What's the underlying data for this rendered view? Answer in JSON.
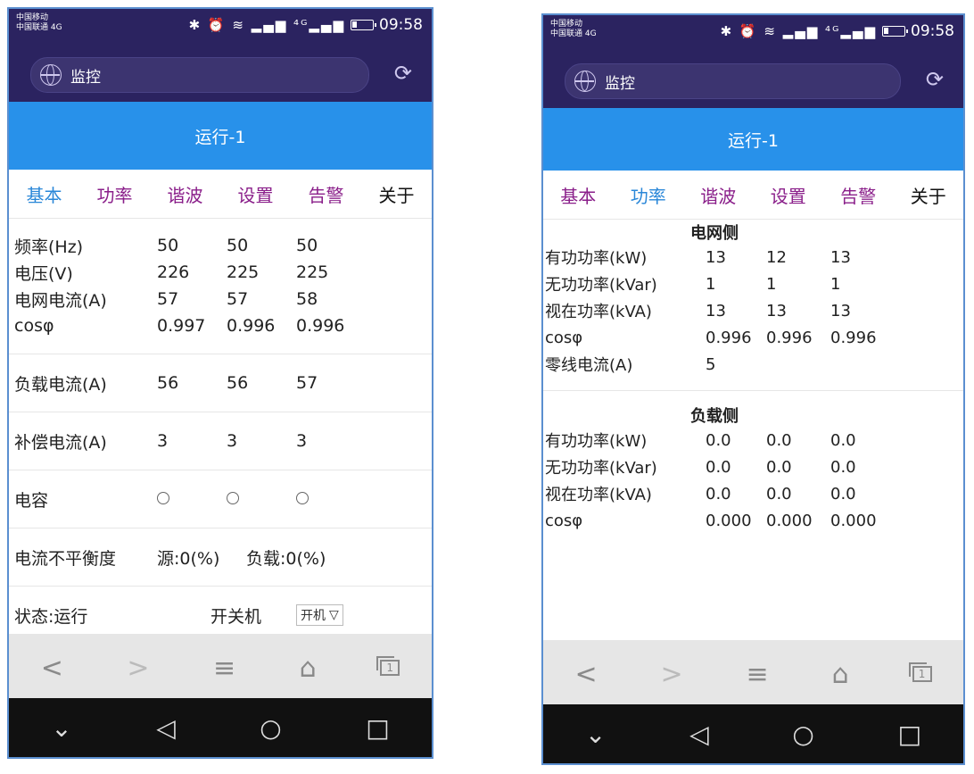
{
  "status_bar": {
    "carrier_line1": "中国移动",
    "carrier_line2": "中国联通 4G",
    "icons": "✱ ⏰ ≋ ▂▄▆ ⁴ᴳ▂▄▆",
    "time": "09:58"
  },
  "browser": {
    "url_text": "监控",
    "refresh_icon": "⟳"
  },
  "page_title": "运行-1",
  "tabs": [
    "基本",
    "功率",
    "谐波",
    "设置",
    "告警",
    "关于"
  ],
  "left": {
    "active_tab": "基本",
    "rows": [
      {
        "label": "频率(Hz)",
        "a": "50",
        "b": "50",
        "c": "50"
      },
      {
        "label": "电压(V)",
        "a": "226",
        "b": "225",
        "c": "225"
      },
      {
        "label": "电网电流(A)",
        "a": "57",
        "b": "57",
        "c": "58"
      },
      {
        "label": "cosφ",
        "a": "0.997",
        "b": "0.996",
        "c": "0.996"
      }
    ],
    "load_current": {
      "label": "负载电流(A)",
      "a": "56",
      "b": "56",
      "c": "57"
    },
    "comp_current": {
      "label": "补偿电流(A)",
      "a": "3",
      "b": "3",
      "c": "3"
    },
    "capacitor": {
      "label": "电容"
    },
    "imbalance": {
      "label": "电流不平衡度",
      "source": "源:0(%)",
      "load": "负载:0(%)"
    },
    "status": {
      "label": "状态:运行",
      "switch_label": "开关机",
      "switch_value": "开机"
    }
  },
  "right": {
    "active_tab": "功率",
    "grid_header": "电网侧",
    "grid_rows": [
      {
        "label": "有功功率(kW)",
        "a": "13",
        "b": "12",
        "c": "13"
      },
      {
        "label": "无功功率(kVar)",
        "a": "1",
        "b": "1",
        "c": "1"
      },
      {
        "label": "视在功率(kVA)",
        "a": "13",
        "b": "13",
        "c": "13"
      },
      {
        "label": "cosφ",
        "a": "0.996",
        "b": "0.996",
        "c": "0.996"
      },
      {
        "label": "零线电流(A)",
        "a": "5",
        "b": "",
        "c": ""
      }
    ],
    "load_header": "负载侧",
    "load_rows": [
      {
        "label": "有功功率(kW)",
        "a": "0.0",
        "b": "0.0",
        "c": "0.0"
      },
      {
        "label": "无功功率(kVar)",
        "a": "0.0",
        "b": "0.0",
        "c": "0.0"
      },
      {
        "label": "视在功率(kVA)",
        "a": "0.0",
        "b": "0.0",
        "c": "0.0"
      },
      {
        "label": "cosφ",
        "a": "0.000",
        "b": "0.000",
        "c": "0.000"
      }
    ]
  },
  "browser_nav": {
    "back": "<",
    "forward": ">",
    "menu": "≡",
    "home": "⌂",
    "tabs": "1"
  },
  "system_nav": {
    "down": "⌄",
    "back": "◁",
    "home": "○",
    "recent": "□"
  },
  "colors": {
    "status_bg": "#2b2360",
    "title_bg": "#2891ea",
    "tab_purple": "#8a1f8a",
    "tab_blue": "#2a87d8"
  }
}
